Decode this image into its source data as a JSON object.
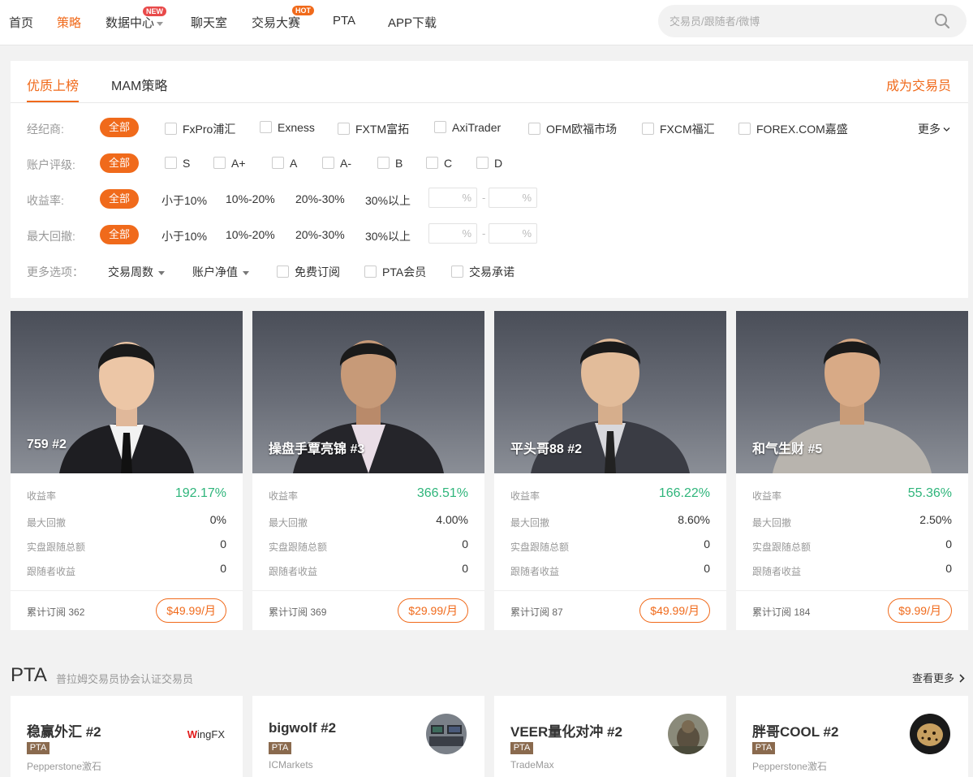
{
  "nav": {
    "items": [
      "首页",
      "策略",
      "数据中心",
      "聊天室",
      "交易大赛",
      "PTA",
      "APP下载"
    ],
    "active": "策略",
    "badge_new": "NEW",
    "badge_hot": "HOT",
    "search_placeholder": "交易员/跟随者/微博"
  },
  "tabs": [
    "优质上榜",
    "MAM策略"
  ],
  "become_trader": "成为交易员",
  "filters": {
    "broker_label": "经纪商:",
    "all": "全部",
    "brokers": [
      "FxPro浦汇",
      "Exness",
      "FXTM富拓",
      "AxiTrader",
      "OFM欧福市场",
      "FXCM福汇",
      "FOREX.COM嘉盛"
    ],
    "more": "更多",
    "rating_label": "账户评级:",
    "ratings": [
      "S",
      "A+",
      "A",
      "A-",
      "B",
      "C",
      "D"
    ],
    "return_label": "收益率:",
    "drawdown_label": "最大回撤:",
    "ranges": [
      "小于10%",
      "10%-20%",
      "20%-30%",
      "30%以上"
    ],
    "pct": "%",
    "dash": "-",
    "more_options_label": "更多选项：",
    "dropdowns": [
      "交易周数",
      "账户净值"
    ],
    "checks": [
      "免费订阅",
      "PTA会员",
      "交易承诺"
    ]
  },
  "stat_labels": [
    "收益率",
    "最大回撤",
    "实盘跟随总额",
    "跟随者收益"
  ],
  "subs_label": "累计订阅",
  "traders": [
    {
      "name": "759 #2",
      "return": "192.17%",
      "drawdown": "0%",
      "follow_total": "0",
      "follower_profit": "0",
      "subs": "362",
      "price": "$49.99/月"
    },
    {
      "name": "操盘手覃亮锦 #3",
      "return": "366.51%",
      "drawdown": "4.00%",
      "follow_total": "0",
      "follower_profit": "0",
      "subs": "369",
      "price": "$29.99/月"
    },
    {
      "name": "平头哥88 #2",
      "return": "166.22%",
      "drawdown": "8.60%",
      "follow_total": "0",
      "follower_profit": "0",
      "subs": "87",
      "price": "$49.99/月"
    },
    {
      "name": "和气生财 #5",
      "return": "55.36%",
      "drawdown": "2.50%",
      "follow_total": "0",
      "follower_profit": "0",
      "subs": "184",
      "price": "$9.99/月"
    }
  ],
  "pta": {
    "title": "PTA",
    "subtitle": "普拉姆交易员协会认证交易员",
    "more": "查看更多",
    "tag": "PTA",
    "cards": [
      {
        "name": "稳赢外汇 #2",
        "broker": "Pepperstone激石",
        "logo_w": "W",
        "logo_rest": "ingFX"
      },
      {
        "name": "bigwolf #2",
        "broker": "ICMarkets"
      },
      {
        "name": "VEER量化对冲 #2",
        "broker": "TradeMax"
      },
      {
        "name": "胖哥COOL #2",
        "broker": "Pepperstone激石"
      }
    ]
  },
  "colors": {
    "accent": "#f06a1b",
    "green": "#2fb57b",
    "pta_tag": "#8a6a4e"
  }
}
